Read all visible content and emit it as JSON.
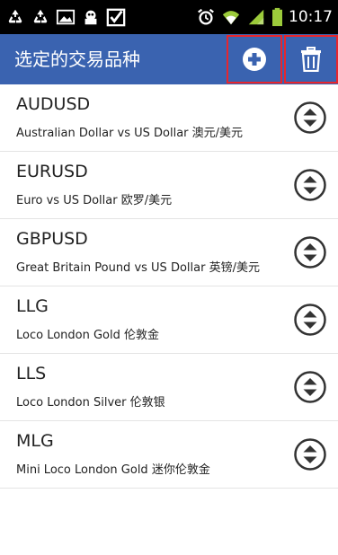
{
  "status_bar": {
    "time": "10:17",
    "left_icons": [
      "recycle-icon",
      "recycle-icon",
      "image-icon",
      "app-icon",
      "checkbox-icon"
    ],
    "right_icons": [
      "alarm-icon",
      "wifi-icon",
      "signal-icon",
      "battery-icon"
    ]
  },
  "app_bar": {
    "title": "选定的交易品种",
    "add_icon": "plus-circle-icon",
    "delete_icon": "trash-icon",
    "background": "#3a63b0",
    "highlight": "#e8262d"
  },
  "symbols": [
    {
      "code": "AUDUSD",
      "description": "Australian Dollar vs US Dollar 澳元/美元"
    },
    {
      "code": "EURUSD",
      "description": "Euro vs US Dollar 欧罗/美元"
    },
    {
      "code": "GBPUSD",
      "description": "Great Britain Pound vs US Dollar 英镑/美元"
    },
    {
      "code": "LLG",
      "description": "Loco London Gold 伦敦金"
    },
    {
      "code": "LLS",
      "description": "Loco London Silver 伦敦银"
    },
    {
      "code": "MLG",
      "description": "Mini Loco London Gold 迷你伦敦金"
    }
  ]
}
